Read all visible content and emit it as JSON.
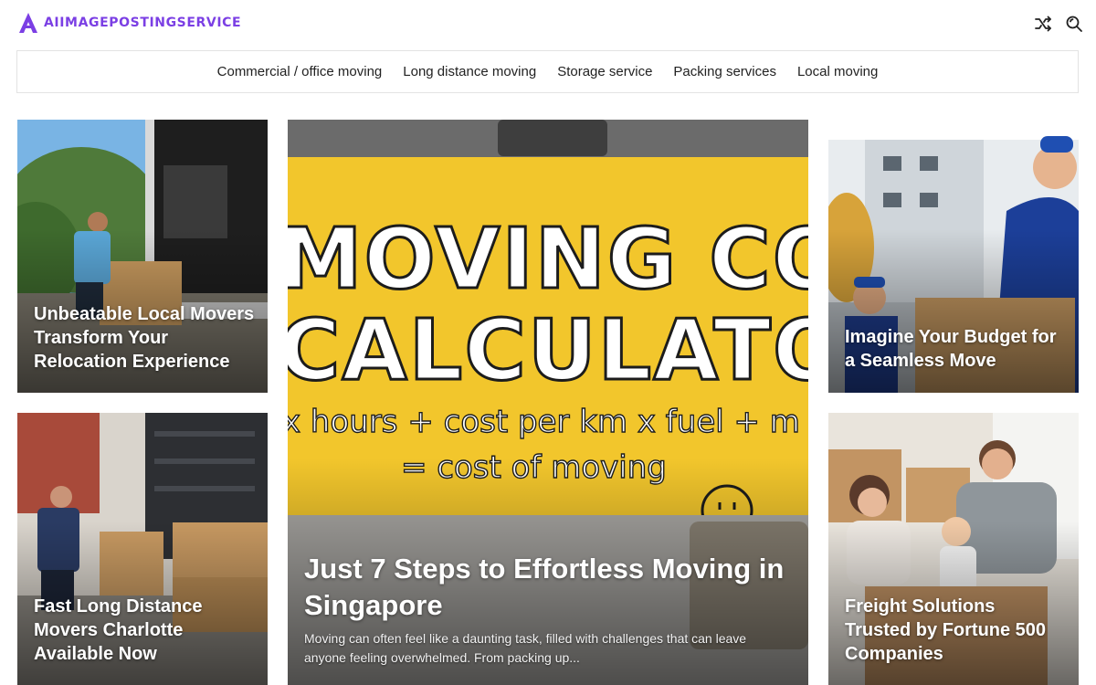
{
  "site": {
    "logo_text": "AIIMAGEPOSTINGSERVICE",
    "brand_color": "#7b3fe4"
  },
  "header": {
    "icons": [
      "shuffle-icon",
      "search-icon"
    ]
  },
  "nav": {
    "items": [
      {
        "label": "Commercial / office moving"
      },
      {
        "label": "Long distance moving"
      },
      {
        "label": "Storage service"
      },
      {
        "label": "Packing services"
      },
      {
        "label": "Local moving"
      }
    ]
  },
  "posts": {
    "left_top": {
      "title": "Unbeatable Local Movers Transform Your Relocation Experience"
    },
    "right_top": {
      "title": "Imagine Your Budget for a Seamless Move"
    },
    "left_bottom": {
      "title": "Fast Long Distance Movers Charlotte Available Now"
    },
    "right_bottom": {
      "title": "Freight Solutions Trusted by Fortune 500 Companies"
    },
    "featured": {
      "title": "Just 7 Steps to Effortless Moving in Singapore",
      "excerpt": "Moving can often feel like a daunting task, filled with challenges that can leave anyone feeling overwhelmed. From packing up...",
      "image_text": {
        "line1": "MOVING COST",
        "line2": "CALCULATOR",
        "line3": "x hours + cost per km x fuel + m",
        "line4": "= cost of moving"
      }
    }
  }
}
